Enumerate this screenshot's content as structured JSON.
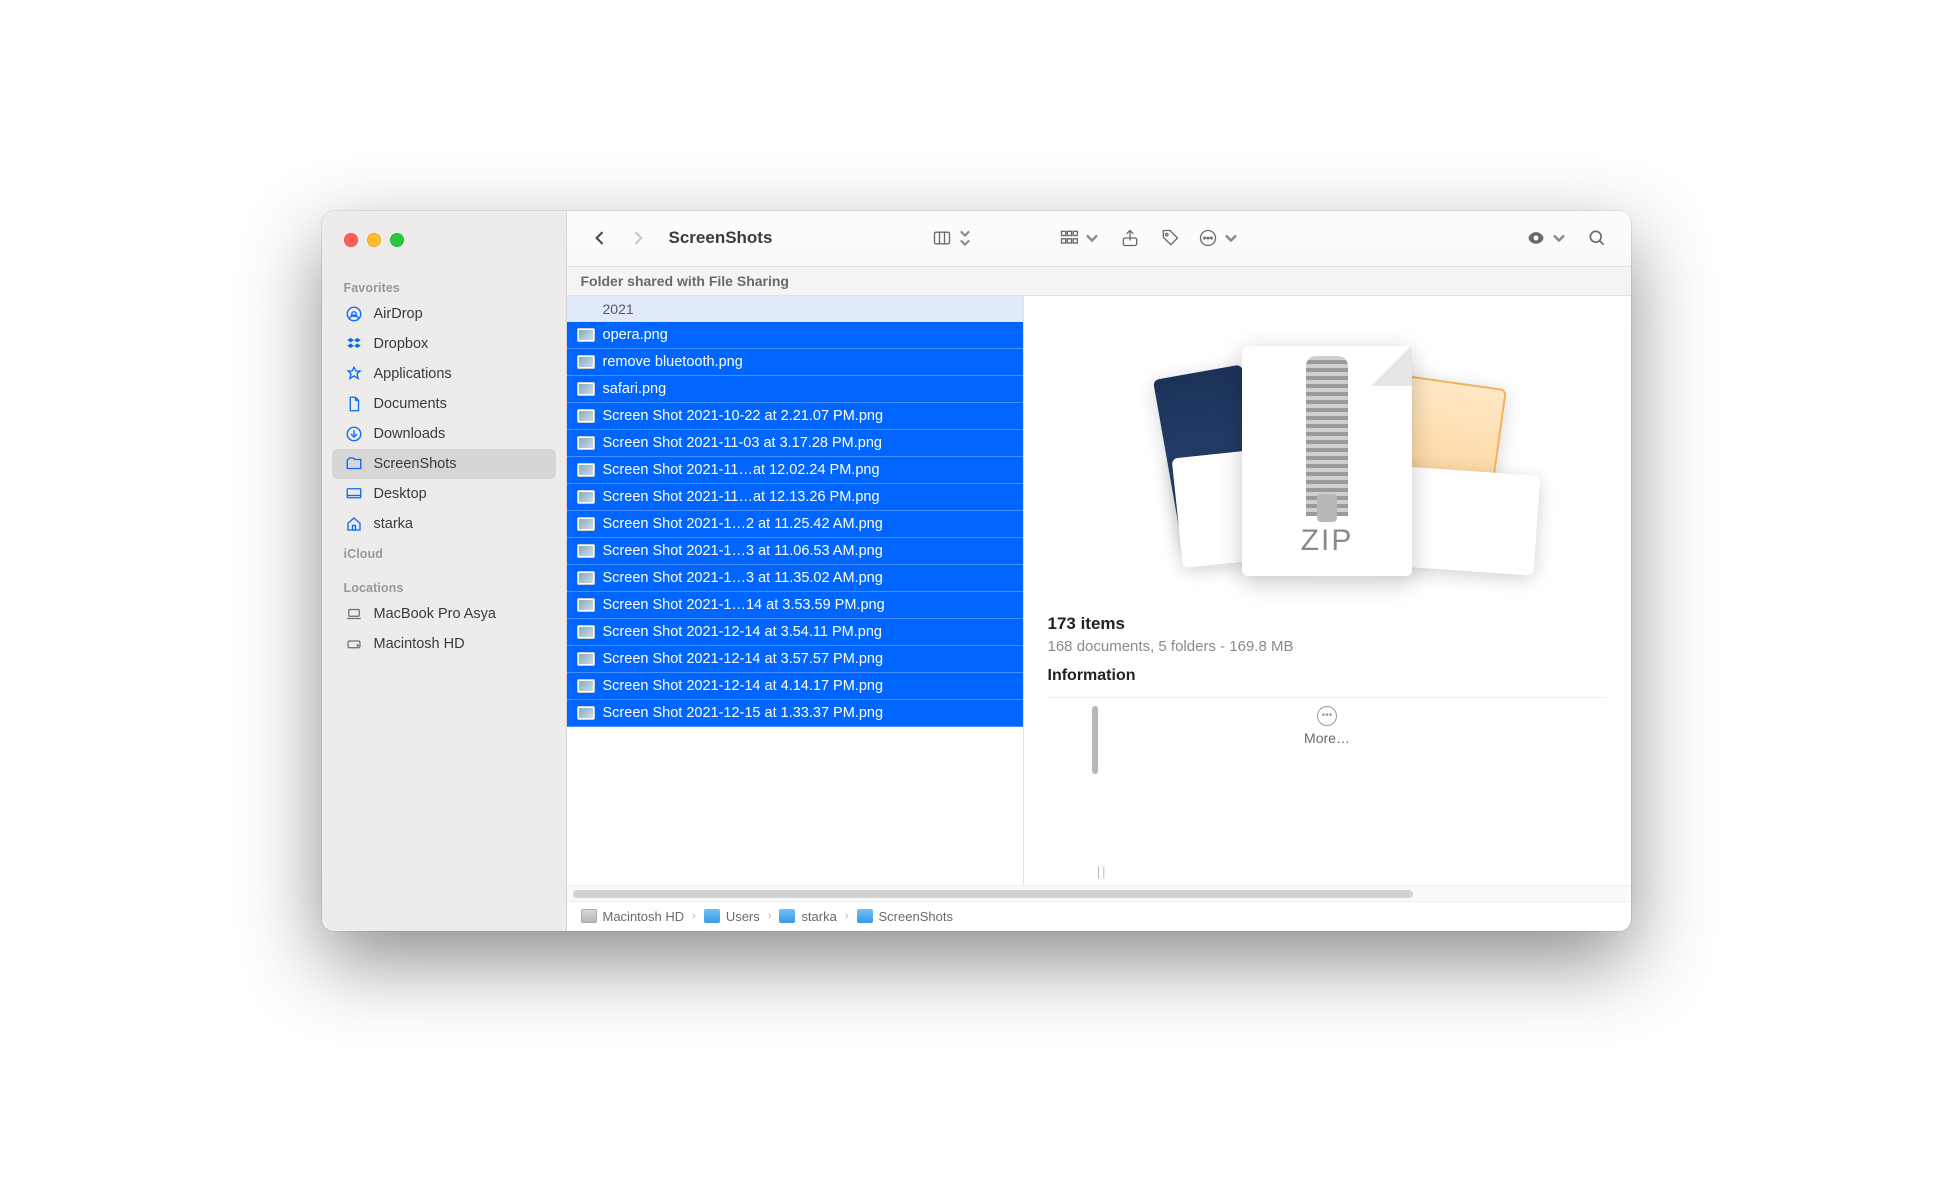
{
  "window_title": "ScreenShots",
  "banner": "Folder shared with File Sharing",
  "year_header": "2021",
  "sidebar": {
    "sections": [
      {
        "label": "Favorites",
        "items": [
          {
            "label": "AirDrop",
            "icon": "airdrop-icon",
            "color": "blue"
          },
          {
            "label": "Dropbox",
            "icon": "dropbox-icon",
            "color": "blue"
          },
          {
            "label": "Applications",
            "icon": "applications-icon",
            "color": "blue"
          },
          {
            "label": "Documents",
            "icon": "document-icon",
            "color": "blue"
          },
          {
            "label": "Downloads",
            "icon": "downloads-icon",
            "color": "blue"
          },
          {
            "label": "ScreenShots",
            "icon": "folder-icon",
            "color": "blue",
            "selected": true
          },
          {
            "label": "Desktop",
            "icon": "desktop-icon",
            "color": "blue"
          },
          {
            "label": "starka",
            "icon": "home-icon",
            "color": "blue"
          }
        ]
      },
      {
        "label": "iCloud",
        "items": []
      },
      {
        "label": "Locations",
        "items": [
          {
            "label": "MacBook Pro Asya",
            "icon": "laptop-icon",
            "color": "gray"
          },
          {
            "label": "Macintosh HD",
            "icon": "disk-icon",
            "color": "gray"
          }
        ]
      }
    ]
  },
  "files": [
    "opera.png",
    "remove bluetooth.png",
    "safari.png",
    "Screen Shot 2021-10-22 at 2.21.07 PM.png",
    "Screen Shot 2021-11-03 at 3.17.28 PM.png",
    "Screen Shot 2021-11…at 12.02.24 PM.png",
    "Screen Shot 2021-11…at 12.13.26 PM.png",
    "Screen Shot 2021-1…2 at 11.25.42 AM.png",
    "Screen Shot 2021-1…3 at 11.06.53 AM.png",
    "Screen Shot 2021-1…3 at 11.35.02 AM.png",
    "Screen Shot 2021-1…14 at 3.53.59 PM.png",
    "Screen Shot 2021-12-14 at 3.54.11 PM.png",
    "Screen Shot 2021-12-14 at 3.57.57 PM.png",
    "Screen Shot 2021-12-14 at 4.14.17 PM.png",
    "Screen Shot 2021-12-15 at 1.33.37 PM.png"
  ],
  "preview": {
    "zip_label": "ZIP",
    "count_title": "173 items",
    "count_sub": "168 documents, 5 folders - 169.8 MB",
    "info_header": "Information",
    "more_label": "More…"
  },
  "pathbar": [
    {
      "label": "Macintosh HD",
      "icon": "hd"
    },
    {
      "label": "Users",
      "icon": "fld"
    },
    {
      "label": "starka",
      "icon": "fld"
    },
    {
      "label": "ScreenShots",
      "icon": "fld"
    }
  ],
  "colors": {
    "accent": "#0a6af6",
    "selection": "#0066ff"
  }
}
